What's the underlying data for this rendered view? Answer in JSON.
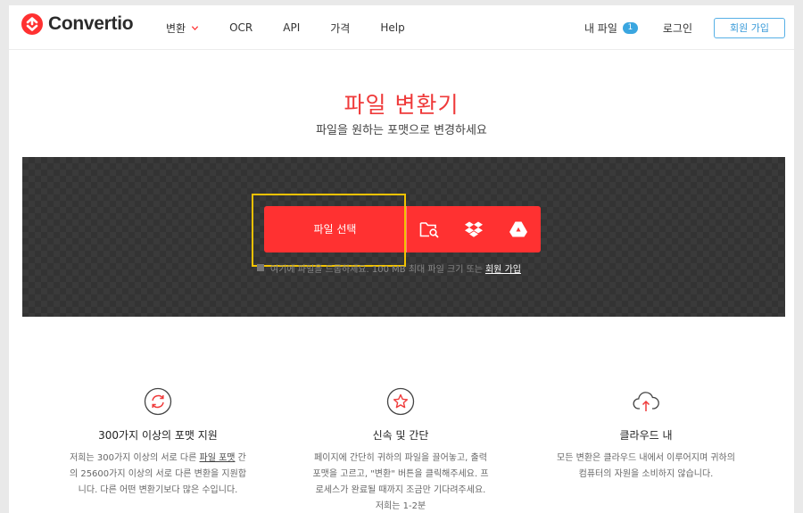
{
  "header": {
    "logo_text": "Convertio",
    "nav": [
      {
        "label": "변환"
      },
      {
        "label": "OCR"
      },
      {
        "label": "API"
      },
      {
        "label": "가격"
      },
      {
        "label": "Help"
      }
    ],
    "my_files_label": "내 파일",
    "my_files_count": "1",
    "login_label": "로그인",
    "signup_label": "회원 가입"
  },
  "hero": {
    "title": "파일 변환기",
    "subtitle": "파일을 원하는 포맷으로 변경하세요"
  },
  "upload": {
    "choose_label": "파일 선택",
    "drop_hint": "여기에 파일을 드롭하세요. 100 MB 최대 파일 크기 또는",
    "signup_link": "회원 가입",
    "sources": [
      "folder-search-icon",
      "dropbox-icon",
      "google-drive-icon"
    ]
  },
  "features": [
    {
      "icon": "refresh-circle-icon",
      "title": "300가지 이상의 포맷 지원",
      "desc_a": "저희는 300가지 이상의 서로 다른 ",
      "desc_link": "파일 포맷",
      "desc_b": " 간의 25600가지 이상의 서로 다른 변환을 지원합니다. 다른 어떤 변환기보다 많은 수입니다."
    },
    {
      "icon": "star-circle-icon",
      "title": "신속 및 간단",
      "desc": "페이지에 간단히 귀하의 파일을 끌어놓고, 출력 포맷을 고르고, \"변환\" 버튼을 클릭해주세요. 프로세스가 완료될 때까지 조금만 기다려주세요. 저희는 1-2분"
    },
    {
      "icon": "cloud-upload-icon",
      "title": "클라우드 내",
      "desc": "모든 변환은 클라우드 내에서 이루어지며 귀하의 컴퓨터의 자원을 소비하지 않습니다."
    }
  ],
  "colors": {
    "brand_red": "#ff3131",
    "title_red": "#ef3a3a",
    "accent_blue": "#3aa6e0",
    "highlight_yellow": "#f2c200"
  }
}
